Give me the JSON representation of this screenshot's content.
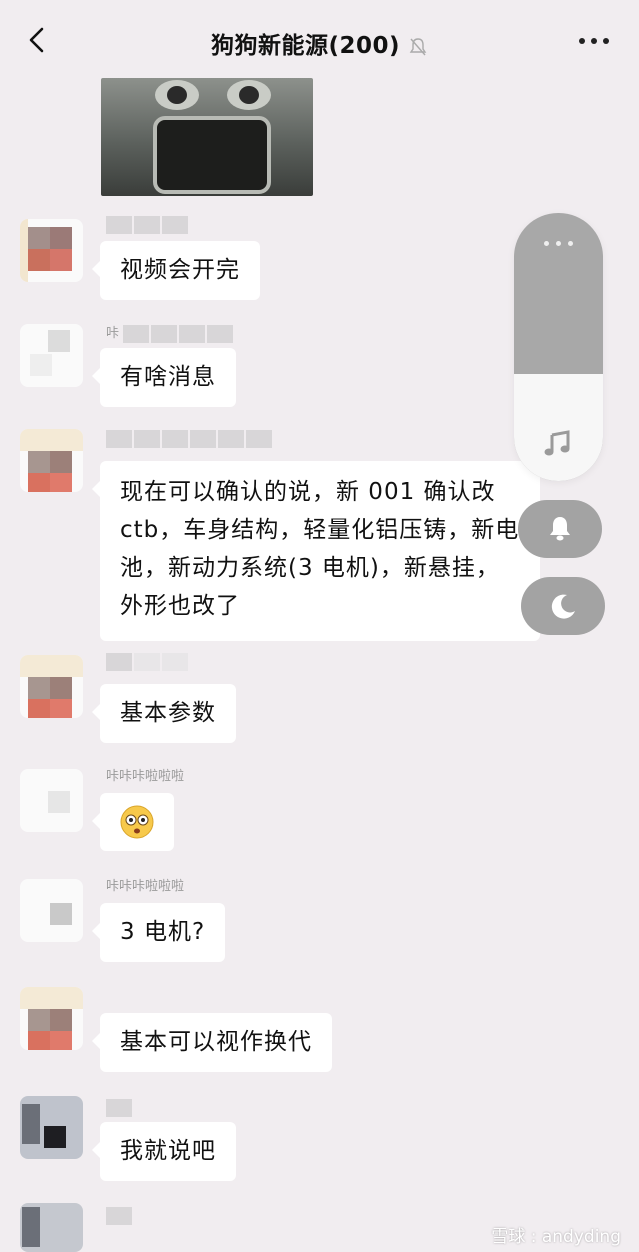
{
  "header": {
    "title": "狗狗新能源(200)"
  },
  "messages": [
    {
      "sender": "",
      "text": "视频会开完"
    },
    {
      "sender": "咔",
      "text": "有啥消息"
    },
    {
      "sender": "",
      "text": "现在可以确认的说，新 001 确认改 ctb，车身结构，轻量化铝压铸，新电池，新动力系统(3 电机)，新悬挂，外形也改了"
    },
    {
      "sender": "",
      "text": "基本参数"
    },
    {
      "sender": "咔咔咔啦啦啦",
      "text": ""
    },
    {
      "sender": "咔咔咔啦啦啦",
      "text": "3 电机?"
    },
    {
      "sender": "",
      "text": "基本可以视作换代"
    },
    {
      "sender": "",
      "text": "我就说吧"
    }
  ],
  "float_panel": {
    "icons": [
      "more-dots-icon",
      "music-note-icon",
      "bell-icon",
      "moon-icon"
    ],
    "level_percent": 40
  },
  "watermark": "雪球 : andyding"
}
